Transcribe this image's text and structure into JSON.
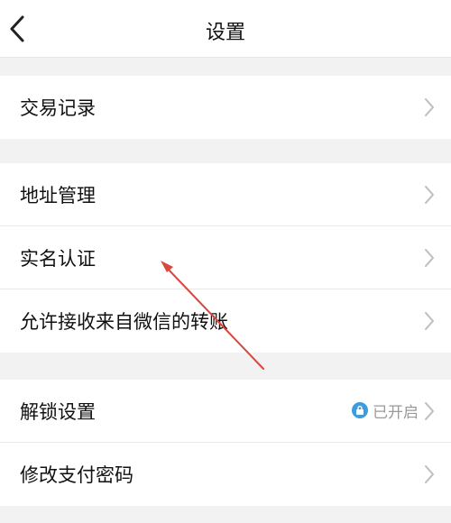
{
  "header": {
    "title": "设置",
    "back_icon": "chevron-left-icon"
  },
  "groups": [
    {
      "items": [
        {
          "label": "交易记录"
        }
      ]
    },
    {
      "items": [
        {
          "label": "地址管理"
        },
        {
          "label": "实名认证"
        },
        {
          "label": "允许接收来自微信的转账"
        }
      ]
    },
    {
      "items": [
        {
          "label": "解锁设置",
          "status": "已开启",
          "status_icon": "lock-icon"
        },
        {
          "label": "修改支付密码"
        }
      ]
    }
  ],
  "colors": {
    "accent": "#3b9dde",
    "annotation_arrow": "#d9473f",
    "background": "#f2f2f2"
  }
}
